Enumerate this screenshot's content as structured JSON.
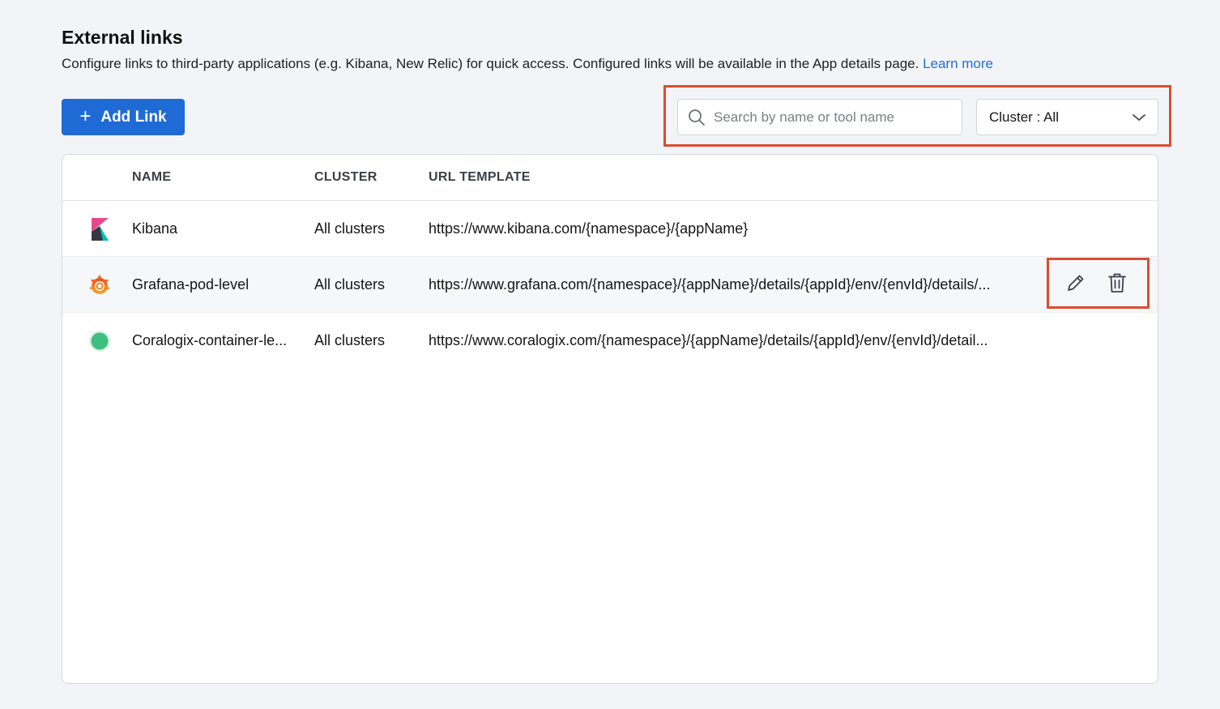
{
  "header": {
    "title": "External links",
    "description": "Configure links to third-party applications (e.g. Kibana, New Relic) for quick access. Configured links will be available in the App details page.",
    "learn_more": "Learn more"
  },
  "toolbar": {
    "add_label": "Add Link",
    "search_placeholder": "Search by name or tool name",
    "cluster_filter": "Cluster : All"
  },
  "table": {
    "columns": [
      "NAME",
      "CLUSTER",
      "URL TEMPLATE"
    ],
    "rows": [
      {
        "icon": "kibana-logo-icon",
        "name": "Kibana",
        "cluster": "All clusters",
        "url": "https://www.kibana.com/{namespace}/{appName}"
      },
      {
        "icon": "grafana-logo-icon",
        "name": "Grafana-pod-level",
        "cluster": "All clusters",
        "url": "https://www.grafana.com/{namespace}/{appName}/details/{appId}/env/{envId}/details/..."
      },
      {
        "icon": "coralogix-logo-icon",
        "name": "Coralogix-container-le...",
        "cluster": "All clusters",
        "url": "https://www.coralogix.com/{namespace}/{appName}/details/{appId}/env/{envId}/detail..."
      }
    ]
  },
  "icons": {
    "add": "plus-icon",
    "search": "search-icon",
    "dropdown": "chevron-down-icon",
    "edit": "pencil-icon",
    "delete": "trash-icon"
  },
  "colors": {
    "primary": "#1f6bd6",
    "link": "#1e6fd9",
    "highlight": "#dd4b2f",
    "coralogix": "#3fbf7f"
  }
}
